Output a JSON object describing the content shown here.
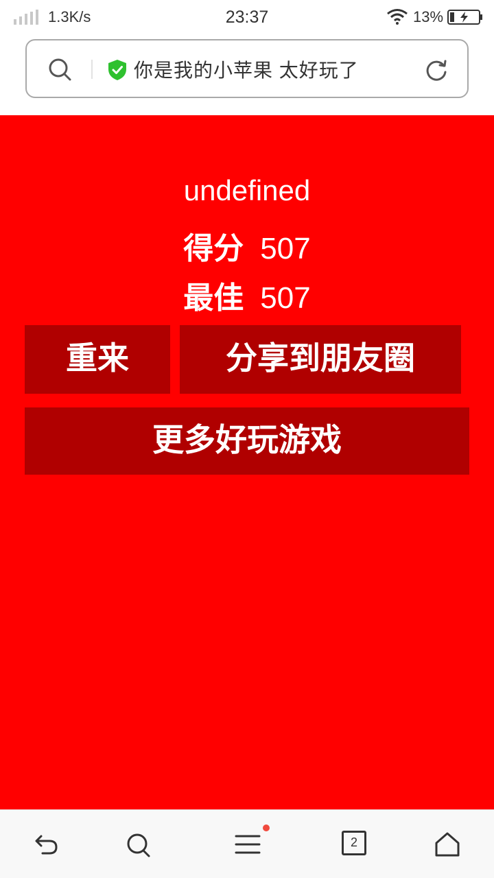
{
  "status_bar": {
    "net_speed": "1.3K/s",
    "time": "23:37",
    "battery_percent": "13%",
    "signal_icon": "signal-icon",
    "wifi_icon": "wifi-icon",
    "battery_icon": "battery-charging-icon"
  },
  "address_bar": {
    "title": "你是我的小苹果 太好玩了",
    "search_icon": "search-icon",
    "secure_icon": "shield-check-icon",
    "refresh_icon": "refresh-icon"
  },
  "game": {
    "title": "undefined",
    "score_label": "得分",
    "score_value": "507",
    "best_label": "最佳",
    "best_value": "507",
    "restart_label": "重来",
    "share_label": "分享到朋友圈",
    "more_label": "更多好玩游戏"
  },
  "bottom_nav": {
    "tabs_count": "2",
    "icons": [
      "back-icon",
      "search-icon",
      "menu-icon",
      "tabs-icon",
      "home-icon"
    ]
  },
  "colors": {
    "game_background": "#ff0000",
    "button_background": "#b00000",
    "secure_green": "#2fc12f",
    "notification_dot": "#f04a3e"
  }
}
